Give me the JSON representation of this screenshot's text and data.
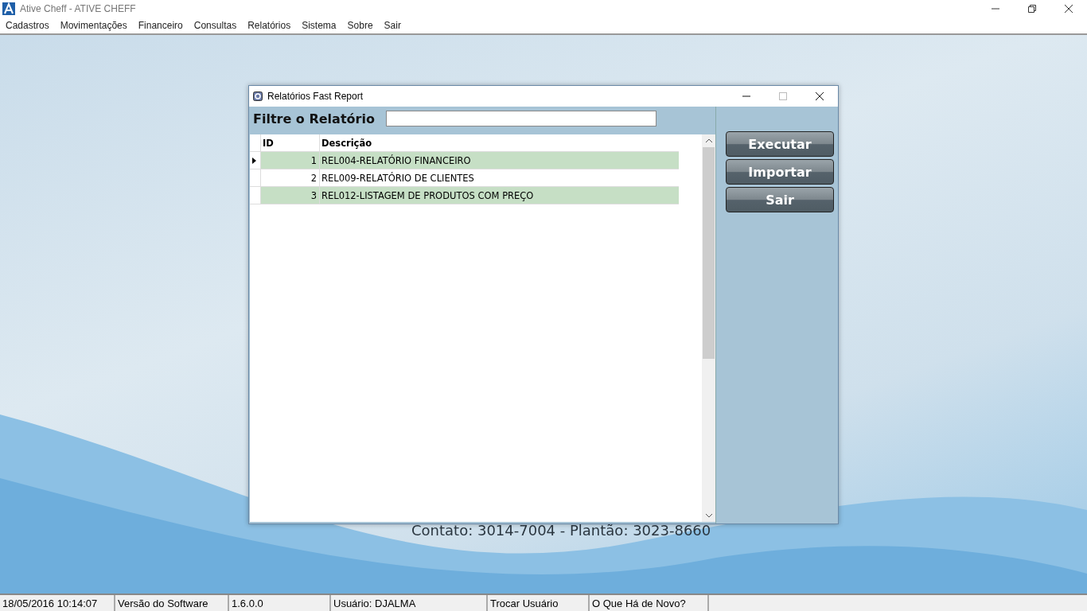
{
  "window": {
    "title": "Ative Cheff - ATIVE CHEFF"
  },
  "menu": [
    "Cadastros",
    "Movimentações",
    "Financeiro",
    "Consultas",
    "Relatórios",
    "Sistema",
    "Sobre",
    "Sair"
  ],
  "contact": "Contato: 3014-7004 - Plantão: 3023-8660",
  "dialog": {
    "title": "Relatórios Fast Report",
    "filter_label": "Filtre o Relatório",
    "columns": [
      "ID",
      "Descrição"
    ],
    "rows": [
      {
        "id": "1",
        "description": "REL004-RELATÓRIO FINANCEIRO",
        "current": true
      },
      {
        "id": "2",
        "description": "REL009-RELATÓRIO DE CLIENTES",
        "current": false
      },
      {
        "id": "3",
        "description": "REL012-LISTAGEM DE PRODUTOS COM PREÇO",
        "current": false
      }
    ],
    "buttons": [
      "Executar",
      "Importar",
      "Sair"
    ]
  },
  "status_bar": [
    "18/05/2016 10:14:07",
    "Versão do Software",
    "1.6.0.0",
    "Usuário: DJALMA",
    "Trocar Usuário",
    "O Que Há de Novo?"
  ]
}
